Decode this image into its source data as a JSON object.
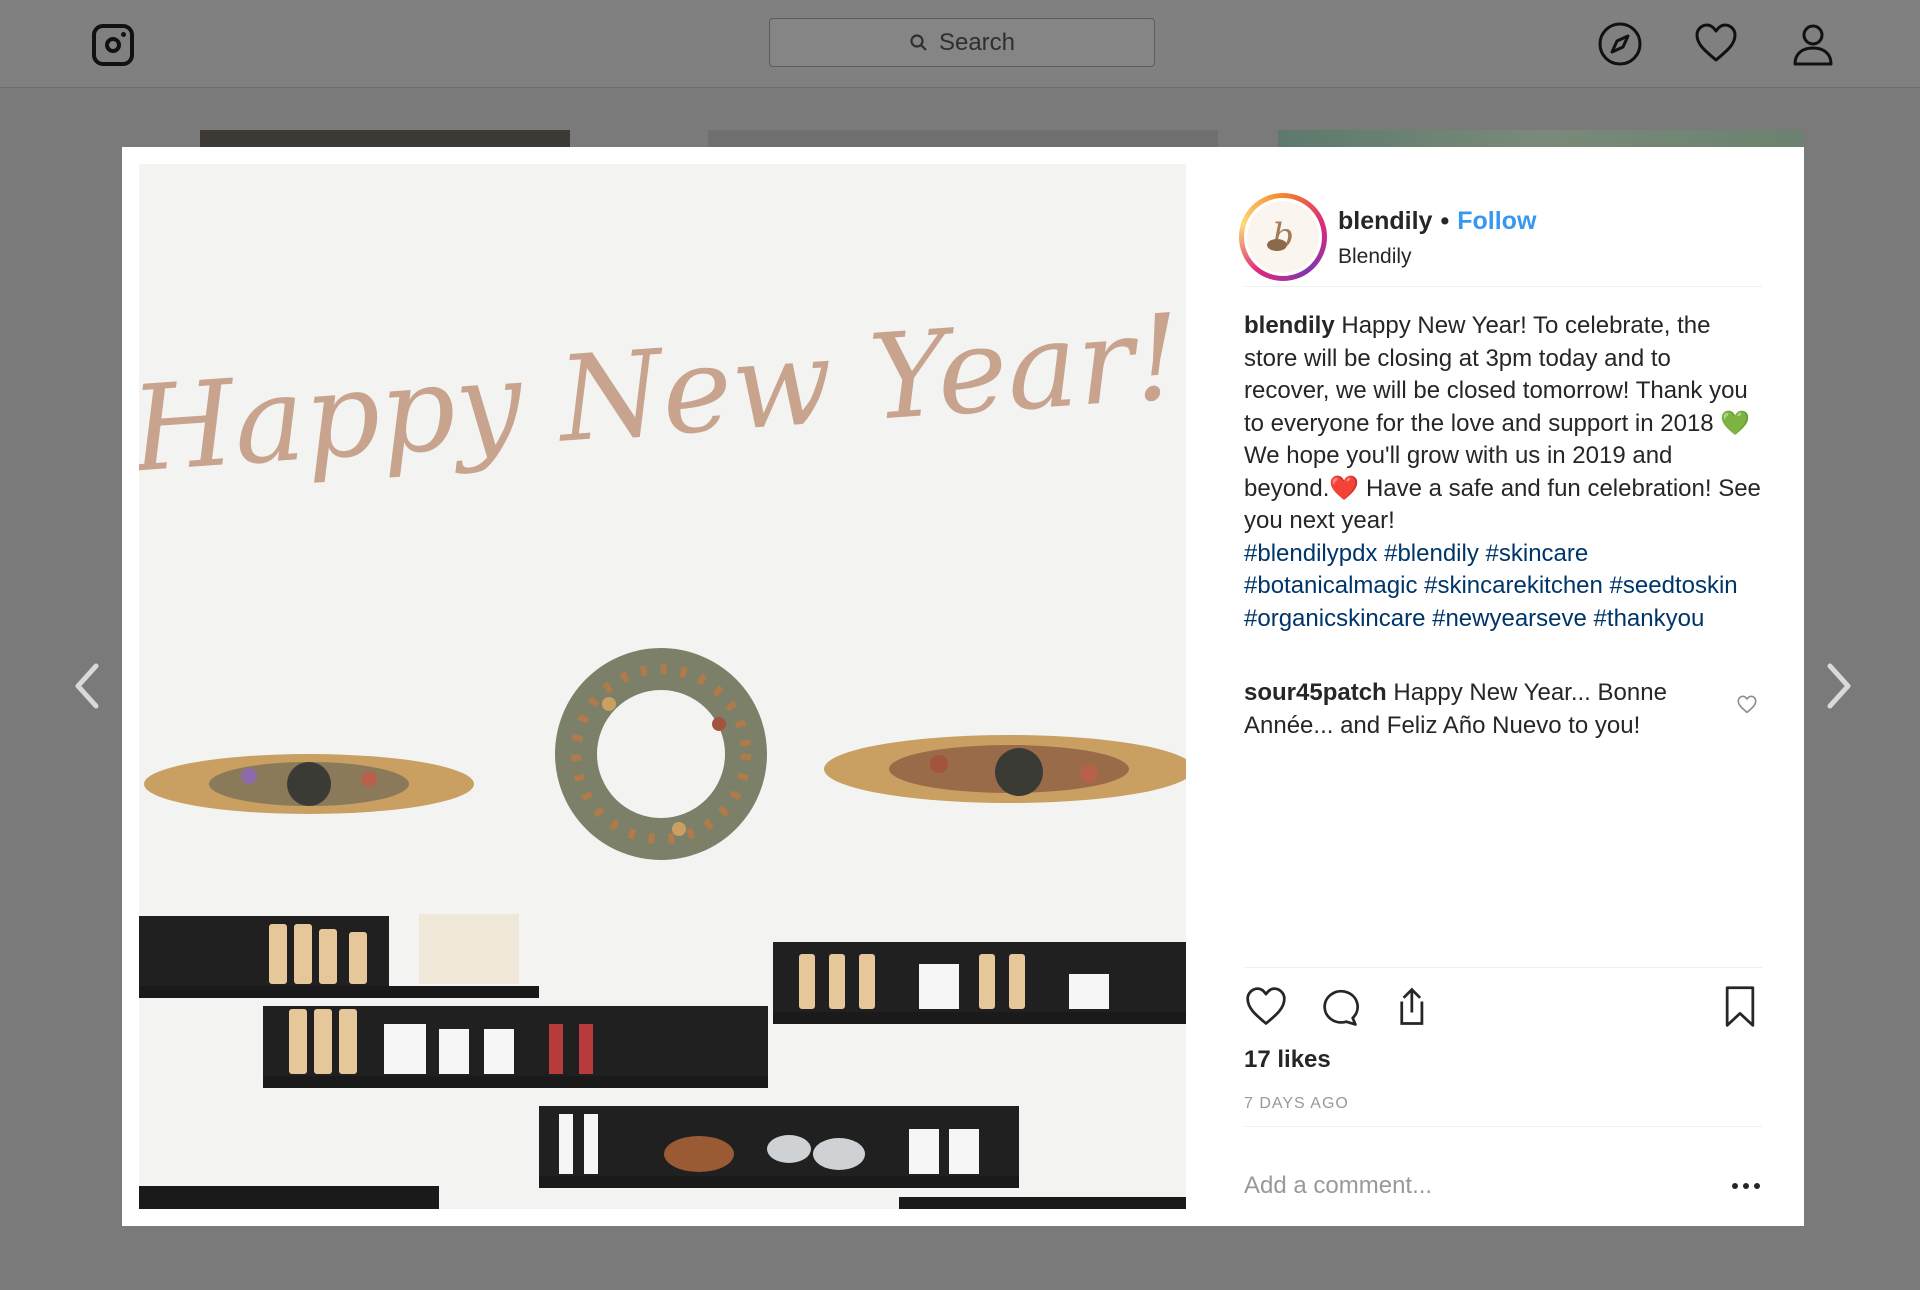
{
  "topbar": {
    "search_placeholder": "Search"
  },
  "post": {
    "username": "blendily",
    "separator": "•",
    "follow_label": "Follow",
    "fullname": "Blendily",
    "image_headline": "Happy New Year!",
    "caption": {
      "username": "blendily",
      "text": "Happy New Year! To celebrate, the store will be closing at 3pm today and to recover, we will be closed tomorrow! Thank you to everyone for the love and support in 2018 💚  We hope you'll grow with us in 2019 and beyond.❤️  Have a safe and fun celebration! See you next year!",
      "hashtags": [
        "#blendilypdx",
        "#blendily",
        "#skincare",
        "#botanicalmagic",
        "#skincarekitchen",
        "#seedtoskin",
        "#organicskincare",
        "#newyearseve",
        "#thankyou"
      ]
    },
    "comments": [
      {
        "username": "sour45patch",
        "text": "Happy New Year... Bonne Année... and Feliz Año Nuevo to you!"
      }
    ],
    "likes": "17 likes",
    "time_ago": "7 DAYS AGO",
    "add_comment_placeholder": "Add a comment..."
  },
  "icons": {
    "logo": "instagram-icon",
    "explore": "compass-icon",
    "activity": "heart-icon",
    "profile": "user-icon",
    "like": "heart-icon",
    "comment": "comment-icon",
    "share": "share-icon",
    "save": "bookmark-icon",
    "more": "ellipsis-icon"
  },
  "colors": {
    "link": "#3897f0",
    "hashtag": "#003569",
    "muted": "#999999",
    "overlay": "#7a7a7a"
  }
}
